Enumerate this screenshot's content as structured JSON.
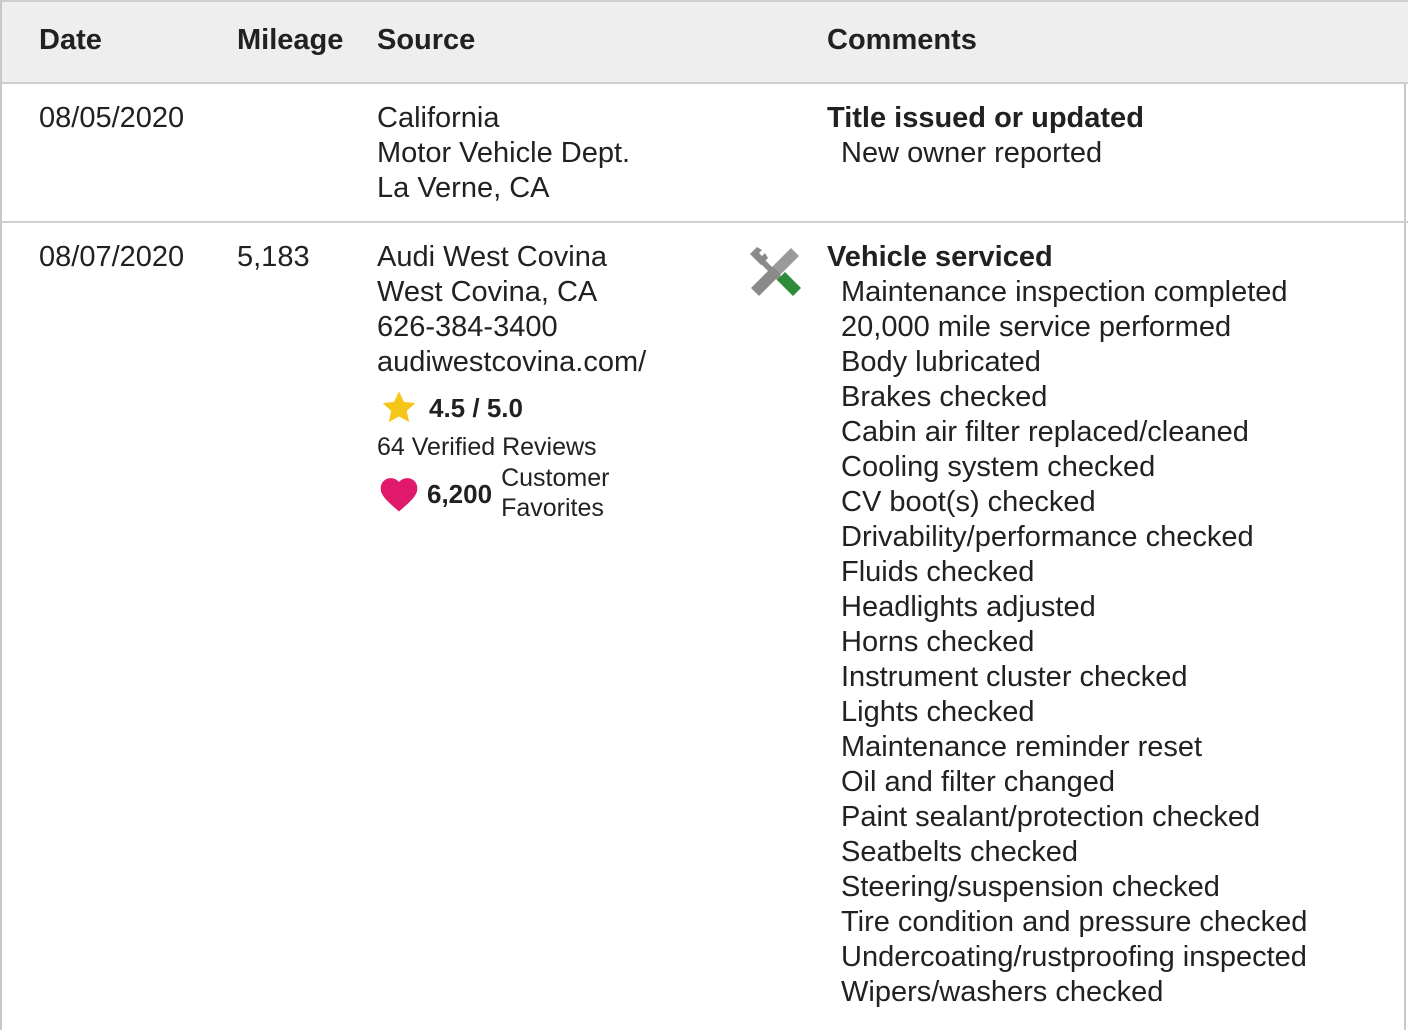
{
  "table": {
    "headers": {
      "date": "Date",
      "mileage": "Mileage",
      "source": "Source",
      "comments": "Comments"
    },
    "rows": [
      {
        "date": "08/05/2020",
        "mileage": "",
        "source": [
          "California",
          "Motor Vehicle Dept.",
          "La Verne, CA"
        ],
        "comment_title": "Title issued or updated",
        "comment_items": [
          "New owner reported"
        ]
      },
      {
        "date": "08/07/2020",
        "mileage": "5,183",
        "source": [
          "Audi West Covina",
          "West Covina, CA",
          "626-384-3400",
          "audiwestcovina.com/"
        ],
        "rating": "4.5 / 5.0",
        "reviews": "64 Verified Reviews",
        "favorites_count": "6,200",
        "favorites_label_1": "Customer",
        "favorites_label_2": "Favorites",
        "icon": "wrench-screwdriver-icon",
        "comment_title": "Vehicle serviced",
        "comment_items": [
          "Maintenance inspection completed",
          "20,000 mile service performed",
          "Body lubricated",
          "Brakes checked",
          "Cabin air filter replaced/cleaned",
          "Cooling system checked",
          "CV boot(s) checked",
          "Drivability/performance checked",
          "Fluids checked",
          "Headlights adjusted",
          "Horns checked",
          "Instrument cluster checked",
          "Lights checked",
          "Maintenance reminder reset",
          "Oil and filter changed",
          "Paint sealant/protection checked",
          "Seatbelts checked",
          "Steering/suspension checked",
          "Tire condition and pressure checked",
          "Undercoating/rustproofing inspected",
          "Wipers/washers checked"
        ]
      }
    ]
  },
  "colors": {
    "header_bg": "#eeeeee",
    "star": "#f5c518",
    "heart": "#e0196b",
    "screwdriver_handle": "#2e8b3a",
    "tool_gray": "#8a8a8a"
  }
}
